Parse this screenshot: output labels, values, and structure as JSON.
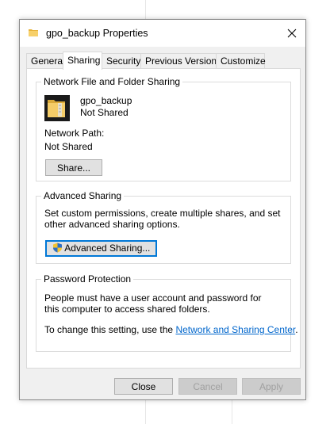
{
  "dialog": {
    "title": "gpo_backup Properties",
    "close_glyph": "✕"
  },
  "tabs": [
    {
      "label": "General",
      "active": false
    },
    {
      "label": "Sharing",
      "active": true
    },
    {
      "label": "Security",
      "active": false
    },
    {
      "label": "Previous Versions",
      "active": false
    },
    {
      "label": "Customize",
      "active": false
    }
  ],
  "network_sharing": {
    "group_title": "Network File and Folder Sharing",
    "folder_name": "gpo_backup",
    "share_status": "Not Shared",
    "network_path_label": "Network Path:",
    "network_path_value": "Not Shared",
    "share_button": "Share..."
  },
  "advanced_sharing": {
    "group_title": "Advanced Sharing",
    "description": "Set custom permissions, create multiple shares, and set other advanced sharing options.",
    "button": "Advanced Sharing..."
  },
  "password_protection": {
    "group_title": "Password Protection",
    "description": "People must have a user account and password for this computer to access shared folders.",
    "change_text": "To change this setting, use the ",
    "link_text": "Network and Sharing Center",
    "change_suffix": "."
  },
  "footer": {
    "close": "Close",
    "cancel": "Cancel",
    "apply": "Apply"
  },
  "colors": {
    "folder": "#f2c75c",
    "link": "#0066cc",
    "accent_border": "#0078d7"
  },
  "icons": {
    "title": "folder-icon",
    "folder": "folder-icon",
    "shield": "uac-shield-icon"
  }
}
